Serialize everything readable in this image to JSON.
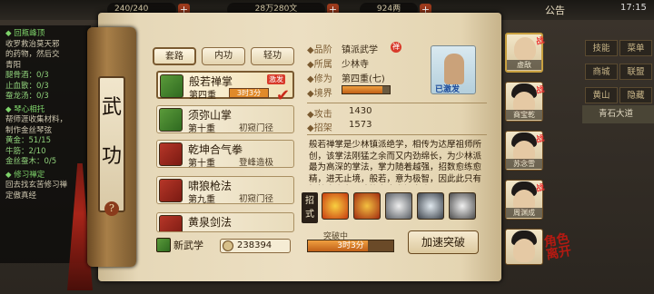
{
  "topbar": {
    "stamina": "240/240",
    "coins": "28万280文",
    "silver": "924两",
    "notice": "公告",
    "clock": "17:15"
  },
  "quest": {
    "items": [
      {
        "title": "◆ 回瓶峰顶",
        "lines": [
          "收罗救治莫天邪",
          "的药物，然后交",
          "青阳",
          "腿骨酒：0/3",
          "止血散：0/3",
          "蚕龙汤：0/3"
        ]
      },
      {
        "title": "◆ 琴心相托",
        "lines": [
          "帮师涯收集材料，",
          "制作金丝琴弦",
          "黄金：51/15",
          "牛筋：2/10",
          "金丝蚕木：0/5"
        ]
      },
      {
        "title": "◆ 修习禅定",
        "lines": [
          "回去找玄苦修习禅",
          "定傲真经"
        ]
      }
    ]
  },
  "scroll": {
    "title_chars": [
      "武",
      "功"
    ],
    "help": "?"
  },
  "tabs": [
    "套路",
    "内功",
    "轻功"
  ],
  "skills": [
    {
      "name": "般若禅掌",
      "level": "第四重",
      "time": "3时3分",
      "badge": "激发",
      "color": "green"
    },
    {
      "name": "须弥山掌",
      "level": "第十重",
      "rank": "初窥门径",
      "color": "green"
    },
    {
      "name": "乾坤合气拳",
      "level": "第十重",
      "rank": "登峰造极",
      "color": "red"
    },
    {
      "name": "啸狼枪法",
      "level": "第九重",
      "rank": "初窥门径",
      "color": "red"
    },
    {
      "name": "黄泉剑法",
      "level": "",
      "rank": "",
      "color": "red"
    }
  ],
  "new_skill": "新武学",
  "points": "238394",
  "detail": {
    "grade_k": "◆品阶",
    "grade_v": "镇派武学",
    "sect_k": "◆所属",
    "sect_v": "少林寺",
    "cult_k": "◆修为",
    "cult_v": "第四重(七)",
    "realm_k": "◆境界",
    "zen": "禅",
    "portrait_tag": "已激发",
    "realm_fill": 0.85,
    "atk_k": "◆攻击",
    "atk_v": "1430",
    "def_k": "◆招架",
    "def_v": "1573",
    "desc": "般若禅掌是少林镇派绝学，相传为达摩祖师所创，该掌法刚猛之余而又内劲绵长，为少林派最为高深的掌法，掌力随着越强，招数愈练愈精，进无止境，般若，意为极智，因此此只有悟性奇高者，才能完全发挥出这"
  },
  "moves_label": [
    "招",
    "式"
  ],
  "breakthrough": {
    "label": "突破中",
    "time": "3时3分",
    "progress": 0.7,
    "speed_label": "加速突破"
  },
  "party": [
    {
      "name": "虚敌",
      "tag": "战"
    },
    {
      "name": "商宝乾",
      "tag": "战"
    },
    {
      "name": "苏念雪",
      "tag": "战"
    },
    {
      "name": "周渊成",
      "tag": "战"
    },
    {
      "name": "",
      "tag": ""
    }
  ],
  "right": {
    "btns": [
      "技能",
      "菜单",
      "商城",
      "联盟"
    ],
    "map_btn": "黄山",
    "fold": "隐藏",
    "place": "青石大道",
    "exit": "角色离开"
  },
  "colors": {
    "accent": "#c06018",
    "scroll": "#ecdfc2",
    "badge": "#d83a2a"
  }
}
